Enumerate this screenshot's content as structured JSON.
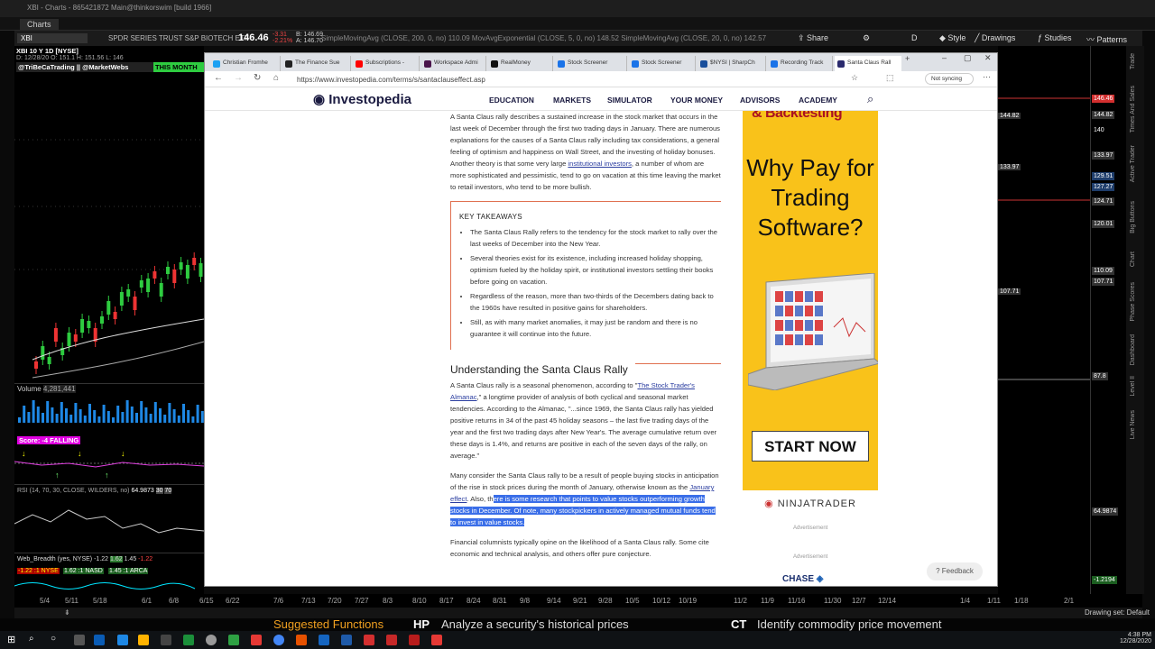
{
  "window": {
    "title": "XBI - Charts - 865421872 Main@thinkorswim [build 1966]",
    "tab": "Charts"
  },
  "toolbar": {
    "symbol": "XBI",
    "name": "SPDR SERIES TRUST S&P BIOTECH ETF",
    "price": "146.46",
    "change": "-3.31",
    "change_pct": "-2.21%",
    "bid": "B: 146.69",
    "ask": "A: 146.70",
    "study_line": "SimpleMovingAvg (CLOSE, 200, 0, no) 110.09  MovAvgExponential (CLOSE, 5, 0, no) 148.52  SimpleMovingAvg (CLOSE, 20, 0, no) 142.57",
    "share": "Share",
    "style": "Style",
    "drawings": "Drawings",
    "studies": "Studies",
    "patterns": "Patterns",
    "period": "D"
  },
  "chart": {
    "header": "XBI 10 Y 1D [NYSE]",
    "ohlc": "D: 12/28/20  O: 151.1  H: 151.56  L: 146",
    "tag_left": "@TriBeCaTrading || @MarketWebs",
    "tag_right": "THIS MONTH",
    "volume_label": "Volume",
    "volume_value": "4,281,441",
    "score": "Score: -4 FALLING",
    "rsi": "RSI (14, 70, 30, CLOSE, WILDERS, no)",
    "rsi_val": "64.9873",
    "rsi_hi": "30",
    "rsi_lo": "70",
    "breadth": "Web_Breadth (yes, NYSE)",
    "breadth_vals": [
      "-1.22",
      "1.62",
      "1.45",
      "-1.22"
    ],
    "breadth_tags": [
      "-1.22 :1 NYSE",
      "1.62 :1 NASD",
      "1.45 :1 ARCA"
    ],
    "price_levels": [
      {
        "v": "146.46",
        "c": "#d32f2f"
      },
      {
        "v": "144.82",
        "c": "#333"
      },
      {
        "v": "140",
        "c": "#000"
      },
      {
        "v": "133.97",
        "c": "#333"
      },
      {
        "v": "129.51",
        "c": "#1e3d6b"
      },
      {
        "v": "127.27",
        "c": "#1e3d6b"
      },
      {
        "v": "124.71",
        "c": "#333"
      },
      {
        "v": "120.01",
        "c": "#333"
      },
      {
        "v": "110.09",
        "c": "#333"
      },
      {
        "v": "107.71",
        "c": "#333"
      },
      {
        "v": "87.8",
        "c": "#333"
      },
      {
        "v": "64.9874",
        "c": "#333"
      },
      {
        "v": "-1.2194",
        "c": "#1b5e20"
      }
    ],
    "overlay_labels": [
      "133.97",
      "144.82",
      "107.71"
    ],
    "side_tabs": [
      "Trade",
      "Times And Sales",
      "Active Trader",
      "Big Buttons",
      "Chart",
      "Phase Scores",
      "Dashboard",
      "Level II",
      "Live News"
    ],
    "dates": [
      "5/4",
      "5/11",
      "5/18",
      "6/1",
      "6/8",
      "6/15",
      "6/22",
      "7/6",
      "7/13",
      "7/20",
      "7/27",
      "8/3",
      "8/10",
      "8/17",
      "8/24",
      "8/31",
      "9/8",
      "9/14",
      "9/21",
      "9/28",
      "10/5",
      "10/12",
      "10/19",
      "11/2",
      "11/9",
      "11/16",
      "11/30",
      "12/7",
      "12/14",
      "1/4",
      "1/11",
      "1/18",
      "2/1"
    ],
    "drawing_set": "Drawing set: Default"
  },
  "browser": {
    "tabs": [
      {
        "label": "Christian Fromhe",
        "color": "#1da1f2"
      },
      {
        "label": "The Finance Sue",
        "color": "#222"
      },
      {
        "label": "Subscriptions - ",
        "color": "#ff0000"
      },
      {
        "label": "Workspace Admi",
        "color": "#4a154b"
      },
      {
        "label": "RealMoney",
        "color": "#111"
      },
      {
        "label": "Stock Screener",
        "color": "#1a73e8"
      },
      {
        "label": "Stock Screener",
        "color": "#1a73e8"
      },
      {
        "label": "$NYSI | SharpCh",
        "color": "#1a4f9c"
      },
      {
        "label": "Recording Track",
        "color": "#1a73e8"
      },
      {
        "label": "Santa Claus Rall",
        "color": "#2b2b6e"
      }
    ],
    "url": "https://www.investopedia.com/terms/s/santaclauseffect.asp",
    "sync": "Not syncing",
    "site": {
      "logo": "Investopedia",
      "nav": [
        "EDUCATION",
        "MARKETS",
        "SIMULATOR",
        "YOUR MONEY",
        "ADVISORS",
        "ACADEMY"
      ]
    },
    "article": {
      "intro_a": "A Santa Claus rally describes a sustained increase in the stock market that occurs in the last week of December through the first two trading days in January. There are numerous explanations for the causes of a Santa Claus rally including tax considerations, a general feeling of optimism and happiness on Wall Street, and the investing of holiday bonuses. Another theory is that some very large ",
      "intro_link": "institutional investors",
      "intro_b": ", a number of whom are more sophisticated and pessimistic, tend to go on vacation at this time leaving the market to retail investors, who tend to be more bullish.",
      "takeaways_title": "KEY TAKEAWAYS",
      "takeaways": [
        "The Santa Claus Rally refers to the tendency for the stock market to rally over the last weeks of December into the New Year.",
        "Several theories exist for its existence, including increased holiday shopping, optimism fueled by the holiday spirit, or institutional investors settling their books before going on vacation.",
        "Regardless of the reason, more than two-thirds of the Decembers dating back to the 1960s have resulted in positive gains for shareholders.",
        "Still, as with many market anomalies, it may just be random and there is no guarantee it will continue into the future."
      ],
      "section_title": "Understanding the Santa Claus Rally",
      "p2_a": "A Santa Claus rally is a seasonal phenomenon, according to \"",
      "p2_link": "The Stock Trader's Almanac",
      "p2_b": ",\" a longtime provider of analysis of both cyclical and seasonal market tendencies. According to the Almanac, \"...since 1969, the Santa Claus rally has yielded positive returns in 34 of the past 45 holiday seasons – the last five trading days of the year and the first two trading days after New Year's. The average cumulative return over these days is 1.4%, and returns are positive in each of the seven days of the rally, on average.\"",
      "p3_a": "Many consider the Santa Claus rally to be a result of people buying stocks in anticipation of the rise in stock prices during the month of January, otherwise known as the ",
      "p3_link": "January effect",
      "p3_b": ". Also, th",
      "p3_hl": "ere is some research that points to value stocks outperforming growth stocks in December. Of note, many stockpickers in actively managed mutual funds tend to invest in value stocks.",
      "p4": "Financial columnists typically opine on the likelihood of a Santa Claus rally. Some cite economic and technical analysis, and others offer pure conjecture."
    },
    "ad": {
      "top": "& Backtesting",
      "headline": "Why Pay for Trading Software?",
      "cta": "START NOW",
      "brand": "NINJATRADER",
      "label": "Advertisement",
      "label2": "Advertisement",
      "chase": "CHASE"
    },
    "feedback": "Feedback"
  },
  "functions": {
    "suggested": "Suggested Functions",
    "items": [
      {
        "code": "HP",
        "desc": "Analyze a security's historical prices"
      },
      {
        "code": "CT",
        "desc": "Identify commodity price movement"
      }
    ]
  },
  "taskbar": {
    "time": "4:38 PM",
    "date": "12/28/2020"
  }
}
